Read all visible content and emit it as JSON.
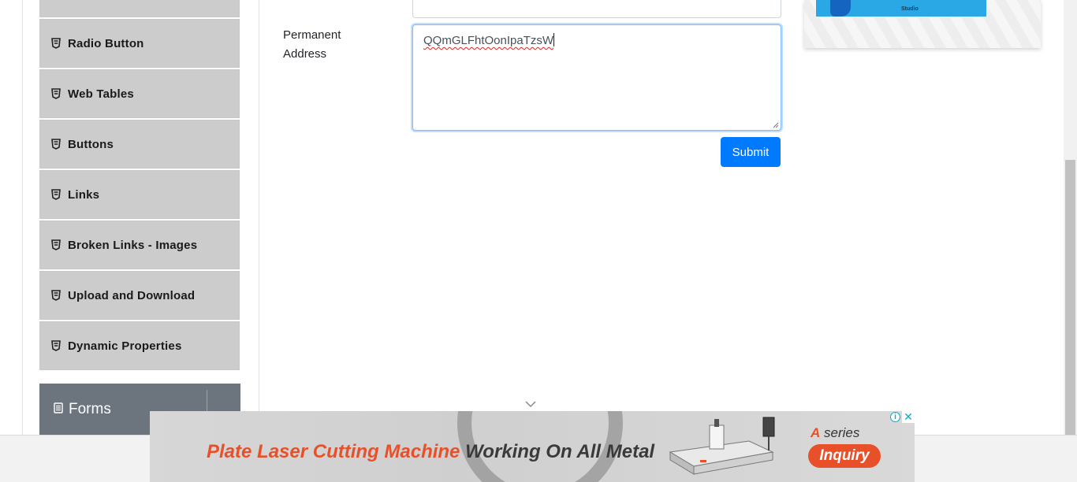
{
  "sidebar": {
    "items": [
      {
        "label": ""
      },
      {
        "label": "Radio Button"
      },
      {
        "label": "Web Tables"
      },
      {
        "label": "Buttons"
      },
      {
        "label": "Links"
      },
      {
        "label": "Broken Links - Images"
      },
      {
        "label": "Upload and Download"
      },
      {
        "label": "Dynamic Properties"
      }
    ],
    "forms_header": {
      "label": "Forms"
    }
  },
  "form": {
    "permanent_address_label": "Permanent Address",
    "permanent_address_value": "QQmGLFhtOonIpaTzsW",
    "submit_label": "Submit"
  },
  "side_ad": {
    "studio_text": "Studio"
  },
  "bottom_ad": {
    "headline_part1": "Plate Laser Cutting Machine",
    "headline_part2": " Working On All Metal",
    "series_letter": "A",
    "series_text": " series",
    "cta_label": "Inquiry",
    "info_icon": "info-icon",
    "close_icon": "close-icon"
  },
  "colors": {
    "primary": "#007bff",
    "sidebar_item_bg": "#cccccc",
    "forms_header_bg": "#6c757d",
    "ad_accent": "#e8502a"
  }
}
